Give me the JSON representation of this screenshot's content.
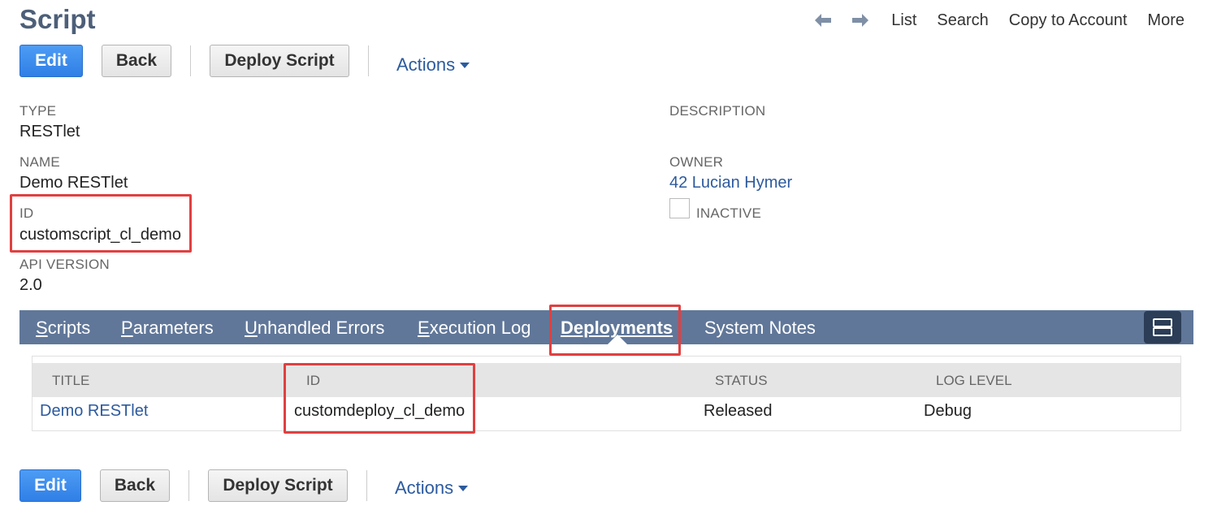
{
  "header": {
    "title": "Script",
    "nav": {
      "back_icon": "arrow-left-icon",
      "forward_icon": "arrow-right-icon",
      "list": "List",
      "search": "Search",
      "copy_to_account": "Copy to Account",
      "more": "More"
    }
  },
  "toolbar": {
    "edit": "Edit",
    "back": "Back",
    "deploy_script": "Deploy Script",
    "actions": "Actions"
  },
  "fields": {
    "type_label": "TYPE",
    "type_value": "RESTlet",
    "name_label": "NAME",
    "name_value": "Demo RESTlet",
    "id_label": "ID",
    "id_value": "customscript_cl_demo",
    "api_version_label": "API VERSION",
    "api_version_value": "2.0",
    "description_label": "DESCRIPTION",
    "owner_label": "OWNER",
    "owner_value": "42 Lucian Hymer",
    "inactive_label": "INACTIVE"
  },
  "tabs": [
    {
      "key": "S",
      "rest": "cripts"
    },
    {
      "key": "P",
      "rest": "arameters"
    },
    {
      "key": "U",
      "rest": "nhandled Errors"
    },
    {
      "key": "E",
      "rest": "xecution Log"
    },
    {
      "key": "D",
      "rest": "eployments"
    },
    {
      "key": "",
      "rest": "System Notes"
    }
  ],
  "active_tab": "Deployments",
  "table": {
    "columns": [
      "TITLE",
      "ID",
      "STATUS",
      "LOG LEVEL"
    ],
    "rows": [
      [
        "Demo RESTlet",
        "customdeploy_cl_demo",
        "Released",
        "Debug"
      ]
    ]
  },
  "colors": {
    "title": "#4d5f79",
    "link": "#2c5a9e",
    "tabbar": "#607799",
    "primary_button": "#2f7fe6",
    "highlight": "#e04040"
  }
}
